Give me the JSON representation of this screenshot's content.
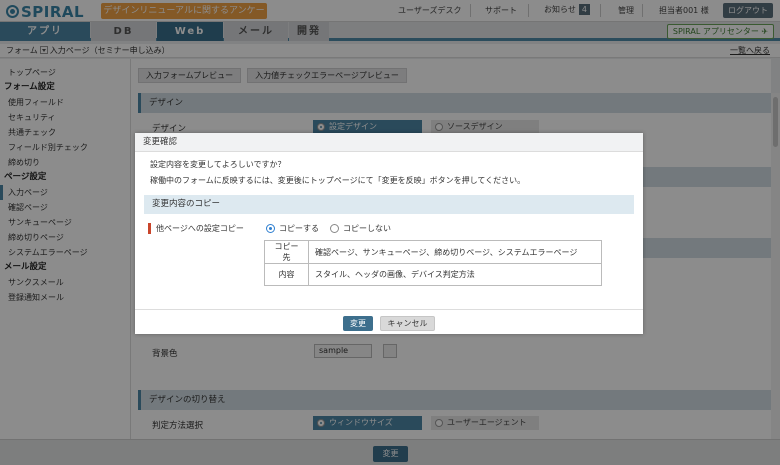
{
  "header": {
    "logo": "SPIRAL",
    "survey_label": "デザインリニューアルに関するアンケート",
    "user_desk": "ユーザーズデスク",
    "support": "サポート",
    "notice": "お知らせ",
    "notice_count": "4",
    "admin": "管理",
    "user": "担当者001 様",
    "logout": "ログアウト"
  },
  "tabs": [
    {
      "label": "アプリ"
    },
    {
      "label": "DB"
    },
    {
      "label": "Web"
    },
    {
      "label": "メール"
    },
    {
      "label": "開発"
    }
  ],
  "app_center": "SPIRAL アプリセンター",
  "breadcrumb": {
    "root": "フォーム",
    "current": "入力ページ（セミナー申し込み）",
    "back": "一覧へ戻る"
  },
  "sidebar": {
    "top": "トップページ",
    "form_settings": {
      "heading": "フォーム設定",
      "items": [
        "使用フィールド",
        "セキュリティ",
        "共通チェック",
        "フィールド別チェック",
        "締め切り"
      ]
    },
    "page_settings": {
      "heading": "ページ設定",
      "items": [
        "入力ページ",
        "確認ページ",
        "サンキューページ",
        "締め切りページ",
        "システムエラーページ"
      ]
    },
    "mail_settings": {
      "heading": "メール設定",
      "items": [
        "サンクスメール",
        "登録通知メール"
      ]
    }
  },
  "main": {
    "preview_input": "入力フォームプレビュー",
    "preview_error": "入力値チェックエラーページプレビュー",
    "design_section": "デザイン",
    "design_label": "デザイン",
    "design_opt_setting": "設定デザイン",
    "design_opt_source": "ソースデザイン",
    "bg_label": "背景色",
    "bg_value": "sample",
    "switch_section": "デザインの切り替え",
    "switch_label": "判定方法選択",
    "switch_opt_window": "ウィンドウサイズ",
    "switch_opt_agent": "ユーザーエージェント"
  },
  "footer": {
    "submit": "変更"
  },
  "dialog": {
    "title": "変更確認",
    "message1": "設定内容を変更してよろしいですか？",
    "message2": "稼働中のフォームに反映するには、変更後にトップページにて「変更を反映」ボタンを押してください。",
    "section": "変更内容のコピー",
    "copy_label": "他ページへの設定コピー",
    "copy_yes": "コピーする",
    "copy_no": "コピーしない",
    "table": [
      {
        "key": "コピー先",
        "value": "確認ページ、サンキューページ、締め切りページ、システムエラーページ"
      },
      {
        "key": "内容",
        "value": "スタイル、ヘッダの画像、デバイス判定方法"
      }
    ],
    "ok": "変更",
    "cancel": "キャンセル"
  },
  "colors": {
    "accent": "#4d87a6",
    "survey": "#f0a246",
    "required_mark": "#c9452b"
  }
}
